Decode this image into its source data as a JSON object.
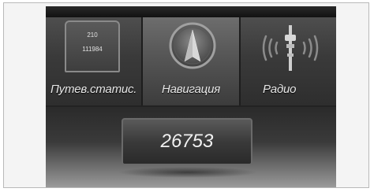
{
  "menu": {
    "items": [
      {
        "label": "Путев.статис.",
        "icon": "trip-stats-icon"
      },
      {
        "label": "Навигация",
        "icon": "navigation-icon"
      },
      {
        "label": "Радио",
        "icon": "radio-tower-icon"
      }
    ],
    "selected": "Навигация"
  },
  "trip_stats_icon": {
    "line1": "210",
    "line2": "111984"
  },
  "odometer": {
    "value": "26753"
  }
}
